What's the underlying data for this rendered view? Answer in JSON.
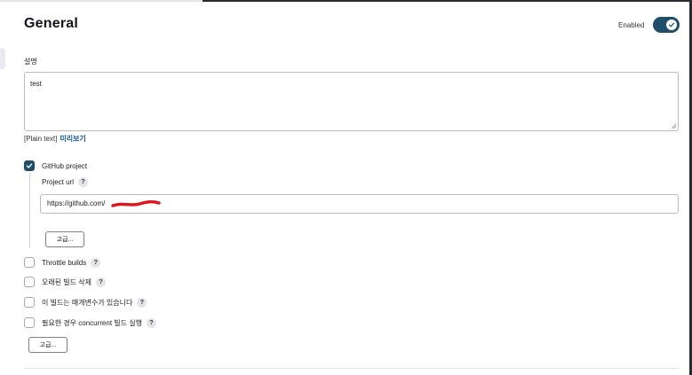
{
  "section": {
    "title": "General"
  },
  "toggle": {
    "label": "Enabled",
    "enabled": true,
    "color": "#1f4e6b"
  },
  "description": {
    "label": "설명",
    "value": "test",
    "plain_text": "[Plain text]",
    "preview_link": "미리보기"
  },
  "github_project": {
    "label": "GitHub project",
    "checked": true,
    "url_label": "Project url",
    "url_value": "https://github.com/",
    "advanced_button": "고급..."
  },
  "options": [
    {
      "label": "Throttle builds",
      "checked": false
    },
    {
      "label": "오래된 빌드 삭제",
      "checked": false
    },
    {
      "label": "이 빌드는 매개변수가 있습니다",
      "checked": false
    },
    {
      "label": "필요한 경우 concurrent 빌드 실행",
      "checked": false
    }
  ],
  "advanced_button": "고급...",
  "help_icon": "?"
}
